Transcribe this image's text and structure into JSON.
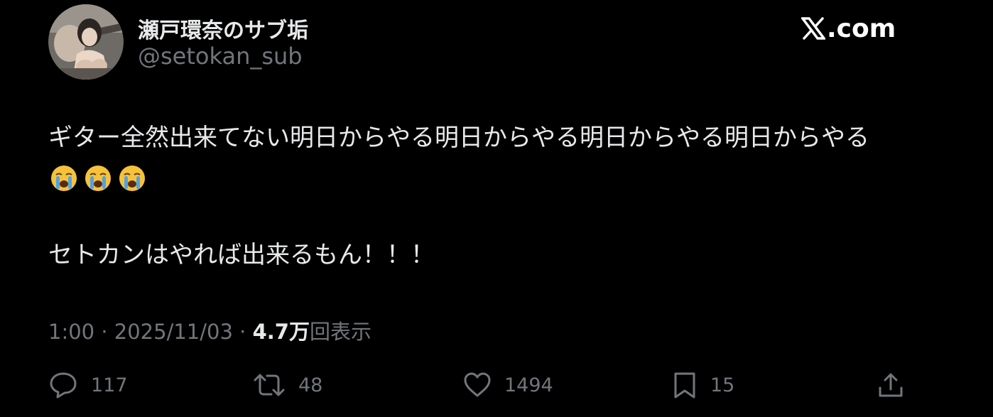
{
  "author": {
    "display_name": "瀬戸環奈のサブ垢",
    "handle": "@setokan_sub",
    "avatar_icon": "profile-photo"
  },
  "brand": {
    "label": ".com",
    "icon": "x-logo-icon"
  },
  "tweet": {
    "line1": "ギター全然出来てない明日からやる明日からやる明日からやる明日からやる",
    "emojis": [
      "loudly-crying-face",
      "loudly-crying-face",
      "loudly-crying-face"
    ],
    "line2": "セトカンはやれば出来るもん！！！"
  },
  "meta": {
    "time": "1:00",
    "separator1": " · ",
    "date": "2025/11/03",
    "separator2": " · ",
    "views": "4.7万",
    "views_label": "回表示"
  },
  "actions": {
    "reply": {
      "icon": "reply-icon",
      "count": "117"
    },
    "retweet": {
      "icon": "retweet-icon",
      "count": "48"
    },
    "like": {
      "icon": "heart-icon",
      "count": "1494"
    },
    "bookmark": {
      "icon": "bookmark-icon",
      "count": "15"
    },
    "share": {
      "icon": "share-icon"
    }
  },
  "colors": {
    "background": "#000000",
    "primary_text": "#e7e9ea",
    "secondary_text": "#71767b"
  }
}
